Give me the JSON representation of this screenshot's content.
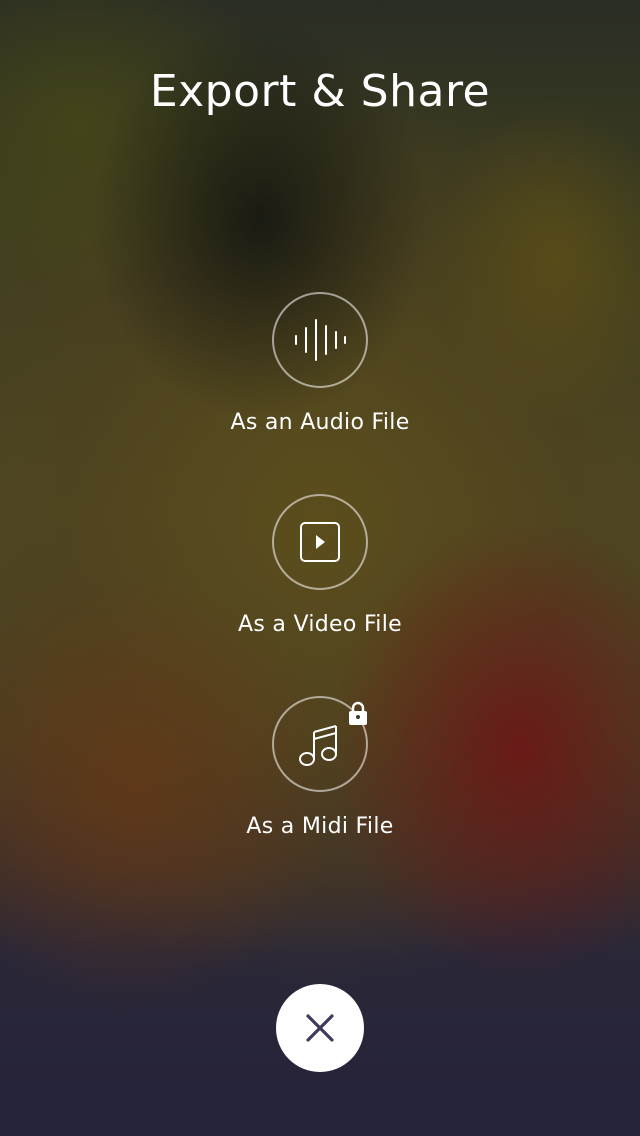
{
  "header": {
    "title": "Export & Share"
  },
  "options": [
    {
      "label": "As an Audio File",
      "icon": "waveform-icon",
      "locked": false
    },
    {
      "label": "As a Video File",
      "icon": "play-icon",
      "locked": false
    },
    {
      "label": "As a Midi File",
      "icon": "music-note-icon",
      "locked": true
    }
  ],
  "close": {
    "icon": "close-icon"
  },
  "colors": {
    "text": "#ffffff",
    "close_background": "#ffffff",
    "close_icon": "#3d3a5c"
  }
}
